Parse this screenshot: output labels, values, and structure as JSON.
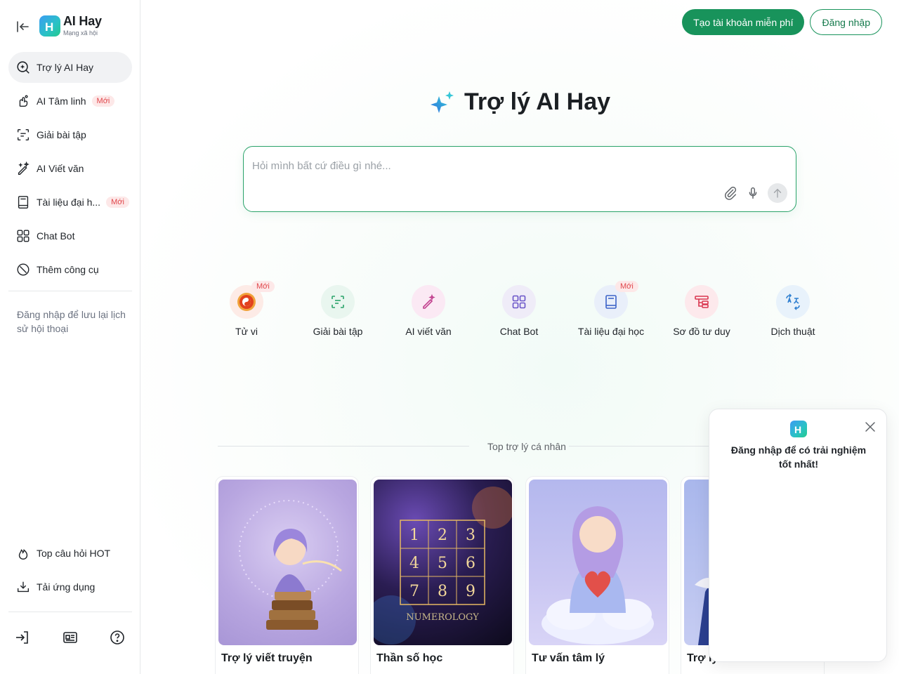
{
  "colors": {
    "brand_green": "#18935b",
    "new_badge_bg": "#fde8e8",
    "new_badge_text": "#e0464b",
    "active_nav_bg": "#f1f2f4"
  },
  "sidebar": {
    "logo": {
      "title": "AI Hay",
      "subtitle": "Mạng xã hội",
      "badge_letter": "H"
    },
    "items": [
      {
        "label": "Trợ lý AI Hay",
        "icon": "search-sparkle-icon",
        "active": true,
        "badge": ""
      },
      {
        "label": "AI Tâm linh",
        "icon": "mystic-hand-icon",
        "active": false,
        "badge": "Mới"
      },
      {
        "label": "Giải bài tập",
        "icon": "scan-text-icon",
        "active": false,
        "badge": ""
      },
      {
        "label": "AI Viết văn",
        "icon": "magic-pen-icon",
        "active": false,
        "badge": ""
      },
      {
        "label": "Tài liệu đại h...",
        "icon": "book-icon",
        "active": false,
        "badge": "Mới"
      },
      {
        "label": "Chat Bot",
        "icon": "grid-apps-icon",
        "active": false,
        "badge": ""
      },
      {
        "label": "Thêm công cụ",
        "icon": "compass-icon",
        "active": false,
        "badge": ""
      }
    ],
    "note": "Đăng nhập để lưu lại lịch sử hội thoại",
    "bottom_items": [
      {
        "label": "Top câu hỏi HOT",
        "icon": "flame-icon"
      },
      {
        "label": "Tải ứng dụng",
        "icon": "download-tray-icon"
      }
    ],
    "footer_icons": [
      "login-icon",
      "news-icon",
      "help-icon"
    ]
  },
  "header": {
    "signup_label": "Tạo tài khoản miễn phí",
    "login_label": "Đăng nhập"
  },
  "hero": {
    "title": "Trợ lý AI Hay",
    "icon": "sparkle-icon"
  },
  "chat": {
    "placeholder": "Hỏi mình bất cứ điều gì nhé...",
    "value": "",
    "tools": [
      "attach-icon",
      "microphone-icon",
      "send-arrow-icon"
    ]
  },
  "quick_actions": [
    {
      "label": "Tử vi",
      "icon": "yin-yang-icon",
      "badge": "Mới",
      "bg": "#fdebe6",
      "fg": "#e35b1b"
    },
    {
      "label": "Giải bài tập",
      "icon": "scan-text-icon",
      "badge": "",
      "bg": "#e9f6ef",
      "fg": "#2aa36a"
    },
    {
      "label": "AI viết văn",
      "icon": "magic-pen-icon",
      "badge": "",
      "bg": "#fbe9f4",
      "fg": "#c2418f"
    },
    {
      "label": "Chat Bot",
      "icon": "grid-apps-icon",
      "badge": "",
      "bg": "#efecf8",
      "fg": "#6a55c8"
    },
    {
      "label": "Tài liệu đại học",
      "icon": "book-icon",
      "badge": "Mới",
      "bg": "#e9effa",
      "fg": "#3d63c8"
    },
    {
      "label": "Sơ đồ tư duy",
      "icon": "mindmap-icon",
      "badge": "",
      "bg": "#fde9ec",
      "fg": "#d9364f"
    },
    {
      "label": "Dịch thuật",
      "icon": "translate-icon",
      "badge": "",
      "bg": "#e8f2fb",
      "fg": "#2f7fd0"
    }
  ],
  "section": {
    "title": "Top trợ lý cá nhân"
  },
  "cards": [
    {
      "title": "Trợ lý viết truyện",
      "image": "girl-writing-on-books-illustration"
    },
    {
      "title": "Thần số học",
      "image": "numerology-grid-galaxy-illustration",
      "grid": [
        "1",
        "2",
        "3",
        "4",
        "5",
        "6",
        "7",
        "8",
        "9"
      ],
      "caption": "NUMEROLOGY"
    },
    {
      "title": "Tư vấn tâm lý",
      "image": "girl-holding-heart-on-cloud-illustration"
    },
    {
      "title": "Trợ lý",
      "image": "partially-hidden-illustration"
    }
  ],
  "popup": {
    "text": "Đăng nhập để có trải nghiệm tốt nhất!",
    "close_icon": "close-icon"
  }
}
